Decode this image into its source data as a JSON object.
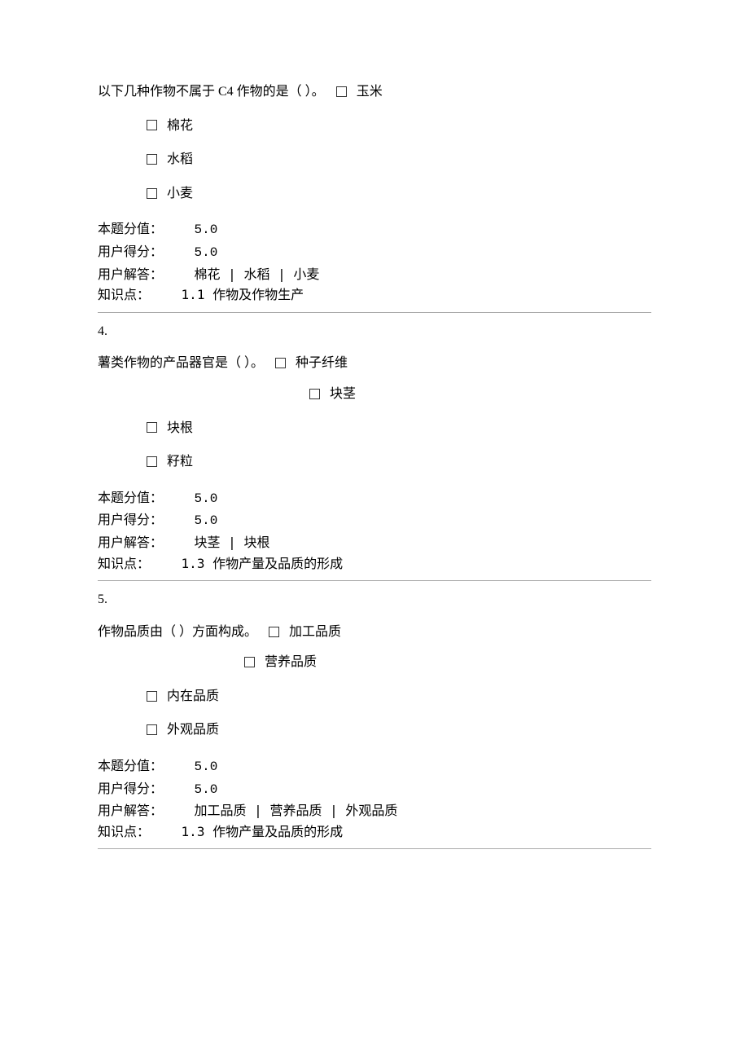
{
  "q3": {
    "stem": "以下几种作物不属于 C4 作物的是（ ）。",
    "opts": [
      "玉米",
      "棉花",
      "水稻",
      "小麦"
    ],
    "score_label": "本题分值：",
    "score_value": "5.0",
    "user_score_label": "用户得分：",
    "user_score_value": "5.0",
    "answer_label": "用户解答：",
    "answer_value": "棉花 | 水稻 | 小麦",
    "kp_label": "知识点：",
    "kp_value": "1.1 作物及作物生产"
  },
  "q4": {
    "num": "4.",
    "stem": "薯类作物的产品器官是（ ）。",
    "opts": [
      "种子纤维",
      "块茎",
      "块根",
      "籽粒"
    ],
    "score_label": "本题分值：",
    "score_value": "5.0",
    "user_score_label": "用户得分：",
    "user_score_value": "5.0",
    "answer_label": "用户解答：",
    "answer_value": "块茎 | 块根",
    "kp_label": "知识点：",
    "kp_value": "1.3 作物产量及品质的形成"
  },
  "q5": {
    "num": "5.",
    "stem": "作物品质由（ ）方面构成。",
    "opts": [
      "加工品质",
      "营养品质",
      "内在品质",
      "外观品质"
    ],
    "score_label": "本题分值：",
    "score_value": "5.0",
    "user_score_label": "用户得分：",
    "user_score_value": "5.0",
    "answer_label": "用户解答：",
    "answer_value": "加工品质 | 营养品质 | 外观品质",
    "kp_label": "知识点：",
    "kp_value": "1.3 作物产量及品质的形成"
  }
}
